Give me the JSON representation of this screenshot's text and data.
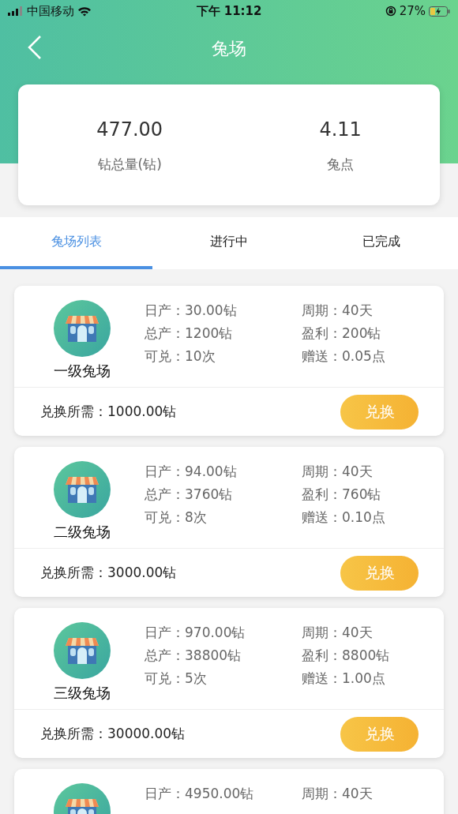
{
  "status_bar": {
    "carrier": "中国移动",
    "time": "下午 11:12",
    "battery": "27%"
  },
  "header": {
    "title": "兔场"
  },
  "stats": [
    {
      "value": "477.00",
      "label": "钻总量(钻)"
    },
    {
      "value": "4.11",
      "label": "兔点"
    }
  ],
  "tabs": [
    {
      "label": "兔场列表",
      "selected": true
    },
    {
      "label": "进行中",
      "selected": false
    },
    {
      "label": "已完成",
      "selected": false
    }
  ],
  "farms": [
    {
      "name": "一级兔场",
      "details": [
        "日产：30.00钻",
        "周期：40天",
        "总产：1200钻",
        "盈利：200钻",
        "可兑：10次",
        "赠送：0.05点"
      ],
      "requirement": "兑换所需：1000.00钻",
      "button": "兑换"
    },
    {
      "name": "二级兔场",
      "details": [
        "日产：94.00钻",
        "周期：40天",
        "总产：3760钻",
        "盈利：760钻",
        "可兑：8次",
        "赠送：0.10点"
      ],
      "requirement": "兑换所需：3000.00钻",
      "button": "兑换"
    },
    {
      "name": "三级兔场",
      "details": [
        "日产：970.00钻",
        "周期：40天",
        "总产：38800钻",
        "盈利：8800钻",
        "可兑：5次",
        "赠送：1.00点"
      ],
      "requirement": "兑换所需：30000.00钻",
      "button": "兑换"
    },
    {
      "details": [
        "日产：4950.00钻",
        "周期：40天"
      ]
    }
  ]
}
